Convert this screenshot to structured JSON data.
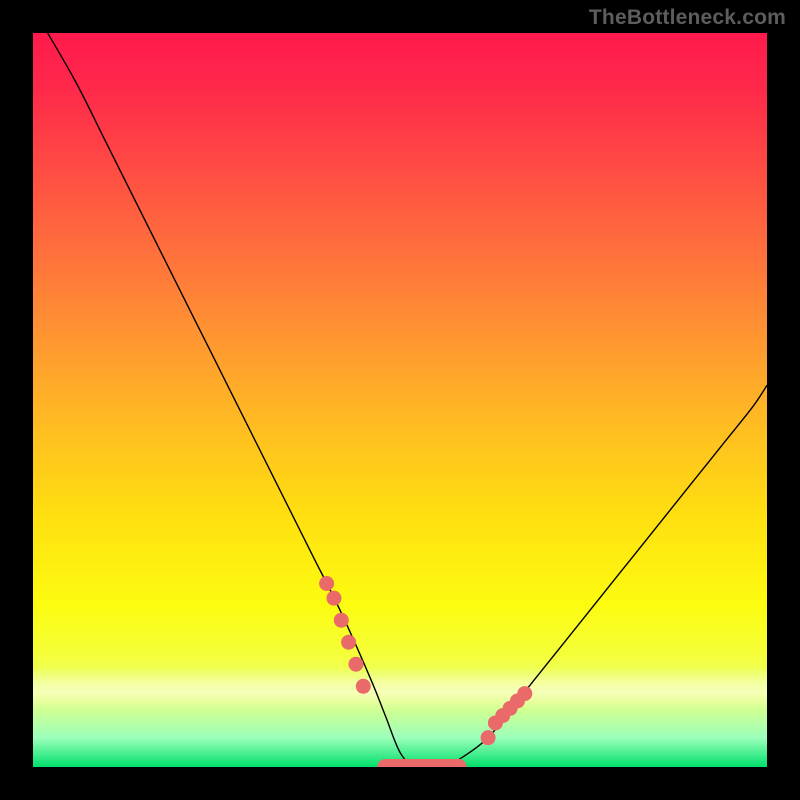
{
  "watermark": "TheBottleneck.com",
  "chart_data": {
    "type": "line",
    "title": "",
    "xlabel": "",
    "ylabel": "",
    "xlim": [
      0,
      100
    ],
    "ylim": [
      0,
      100
    ],
    "legend": false,
    "grid": false,
    "series": [
      {
        "name": "bottleneck-curve",
        "x": [
          2,
          6,
          10,
          14,
          18,
          22,
          26,
          30,
          34,
          38,
          42,
          46,
          48,
          50,
          52,
          54,
          56,
          58,
          62,
          66,
          70,
          74,
          78,
          82,
          86,
          90,
          94,
          98,
          100
        ],
        "values": [
          100,
          93,
          85,
          77,
          69,
          61,
          53,
          45,
          37,
          29,
          21,
          12,
          7,
          2,
          0,
          0,
          0,
          1,
          4,
          9,
          14,
          19,
          24,
          29,
          34,
          39,
          44,
          49,
          52
        ]
      }
    ],
    "markers": {
      "name": "highlighted-points",
      "x": [
        40,
        41,
        42,
        43,
        44,
        45,
        62,
        63,
        64,
        65,
        66,
        67
      ],
      "values": [
        25,
        23,
        20,
        17,
        14,
        11,
        4,
        6,
        7,
        8,
        9,
        10
      ]
    },
    "flat_segment": {
      "x_start": 48,
      "x_end": 58,
      "y": 0
    },
    "gradient": {
      "orientation": "vertical",
      "stops": [
        {
          "pos": 0,
          "color": "#ff1a4d"
        },
        {
          "pos": 50,
          "color": "#ffb824"
        },
        {
          "pos": 80,
          "color": "#fdfd10"
        },
        {
          "pos": 100,
          "color": "#00e06a"
        }
      ]
    }
  }
}
